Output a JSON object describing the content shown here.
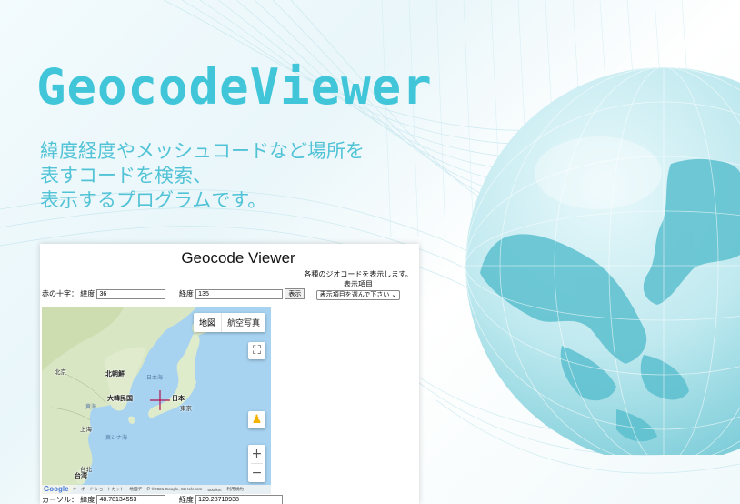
{
  "hero": {
    "title": "GeocodeViewer",
    "description": [
      "緯度経度やメッシュコードなど場所を",
      "表すコードを検索、",
      "表示するプログラムです。"
    ]
  },
  "app": {
    "title": "Geocode Viewer",
    "cross_label": "赤の十字：",
    "lat_label": "緯度",
    "lat_value": "36",
    "lon_label": "経度",
    "lon_value": "135",
    "show_button": "表示",
    "side_info": "各種のジオコードを表示します。",
    "display_item_label": "表示項目",
    "display_item_select": "表示項目を選んで下さい",
    "map_type": {
      "map": "地図",
      "satellite": "航空写真"
    },
    "places": {
      "beijing": "北京",
      "north_korea": "北朝鮮",
      "south_korea": "大韓民国",
      "japan": "日本",
      "tokyo": "東京",
      "sea_of_japan": "日本海",
      "yellow_sea": "黄海",
      "shanghai": "上海",
      "east_china_sea": "東シナ海",
      "taipei": "台北",
      "taiwan": "台湾"
    },
    "footer": {
      "shortcuts": "キーボード ショートカット",
      "data": "地図データ ©2021 Google, SK telecom",
      "scale": "500 km",
      "terms": "利用規約"
    },
    "google_logo": "Google",
    "cursor_label": "カーソル：",
    "cursor_lat_label": "緯度",
    "cursor_lat_value": "48.78134553",
    "cursor_lon_label": "経度",
    "cursor_lon_value": "129.28710938"
  },
  "colors": {
    "accent": "#40c6d8",
    "crosshair": "#b3124d",
    "sea": "#a7d3f1",
    "land": "#d8e8c9"
  }
}
